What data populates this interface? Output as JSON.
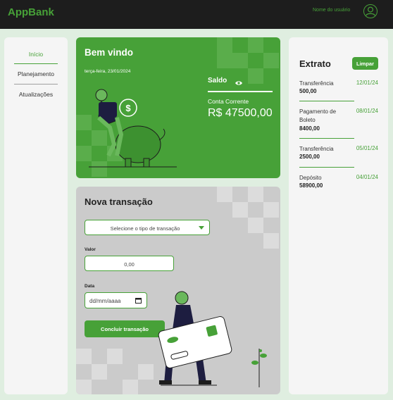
{
  "header": {
    "app_name": "AppBank",
    "user_name": "Nome do usuário"
  },
  "sidebar": {
    "items": [
      {
        "label": "Início",
        "active": true
      },
      {
        "label": "Planejamento",
        "active": false
      },
      {
        "label": "Atualizações",
        "active": false
      }
    ]
  },
  "welcome": {
    "title": "Bem vindo",
    "date": "terça-feira, 23/01/2024",
    "balance_label": "Saldo",
    "account_type": "Conta Corrente",
    "balance_value": "R$ 47500,00"
  },
  "transaction": {
    "title": "Nova transação",
    "type_placeholder": "Selecione o tipo de transação",
    "value_label": "Valor",
    "value_placeholder": "0,00",
    "date_label": "Data",
    "date_placeholder": "dd/mm/aaaa",
    "submit_label": "Concluir transação"
  },
  "statement": {
    "title": "Extrato",
    "clear_label": "Limpar",
    "entries": [
      {
        "type": "Transferência",
        "date": "12/01/24",
        "amount": "500,00"
      },
      {
        "type": "Pagamento de Boleto",
        "date": "08/01/24",
        "amount": "8400,00"
      },
      {
        "type": "Transferência",
        "date": "05/01/24",
        "amount": "2500,00"
      },
      {
        "type": "Depósito",
        "date": "04/01/24",
        "amount": "58900,00"
      }
    ]
  },
  "colors": {
    "accent": "#47a138",
    "topbar": "#1d1d1d",
    "background": "#dfeee0",
    "panel": "#f5f5f5",
    "transaction_panel": "#cbcbcb"
  },
  "icons": [
    "user-avatar-icon",
    "eye-icon",
    "chevron-down-icon",
    "calendar-icon"
  ]
}
